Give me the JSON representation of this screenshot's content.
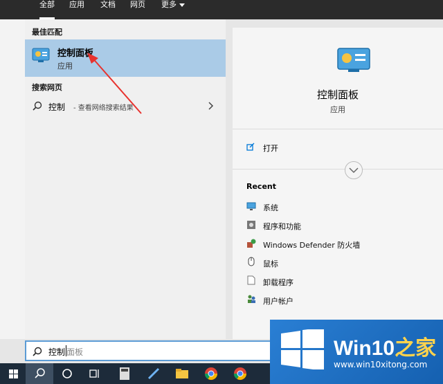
{
  "tabs": [
    {
      "label": "全部",
      "active": true
    },
    {
      "label": "应用"
    },
    {
      "label": "文档"
    },
    {
      "label": "网页"
    },
    {
      "label": "更多"
    }
  ],
  "results": {
    "best_match_header": "最佳匹配",
    "best": {
      "title": "控制面板",
      "subtitle": "应用"
    },
    "web_header": "搜索网页",
    "web": {
      "query": "控制",
      "suffix": "- 查看网络搜索结果"
    }
  },
  "detail": {
    "title": "控制面板",
    "subtitle": "应用",
    "open_label": "打开",
    "recent_header": "Recent",
    "recent": [
      {
        "label": "系统",
        "icon": "monitor-icon"
      },
      {
        "label": "程序和功能",
        "icon": "programs-icon"
      },
      {
        "label": "Windows Defender 防火墙",
        "icon": "firewall-icon"
      },
      {
        "label": "鼠标",
        "icon": "mouse-icon"
      },
      {
        "label": "卸载程序",
        "icon": "document-icon"
      },
      {
        "label": "用户帐户",
        "icon": "users-icon"
      }
    ]
  },
  "search": {
    "typed": "控制",
    "suggestion": "面板"
  },
  "watermark": {
    "brand": "Win10",
    "brand_suffix": "之家",
    "url": "www.win10xitong.com"
  },
  "colors": {
    "accent": "#0078d7",
    "highlight": "#aacbe7",
    "arrow": "#e8322e"
  }
}
